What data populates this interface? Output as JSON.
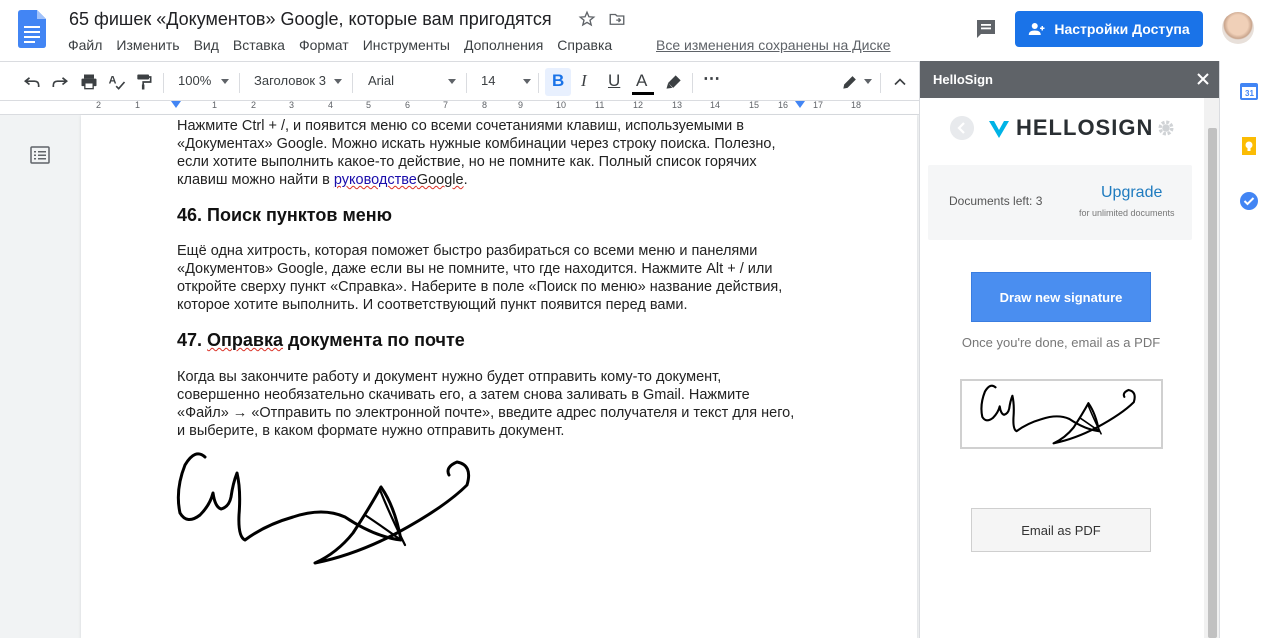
{
  "document": {
    "title": "65 фишек «Документов» Google, которые вам пригодятся",
    "saved_status": "Все изменения сохранены на Диске"
  },
  "menu": [
    "Файл",
    "Изменить",
    "Вид",
    "Вставка",
    "Формат",
    "Инструменты",
    "Дополнения",
    "Справка"
  ],
  "share": {
    "label": "Настройки Доступа"
  },
  "toolbar": {
    "zoom": "100%",
    "style": "Заголовок 3",
    "font": "Arial",
    "size": "14",
    "bold": "B",
    "italic": "I",
    "underline": "U",
    "text_color": "A",
    "more": "⋯"
  },
  "ruler": [
    "2",
    "1",
    "1",
    "2",
    "3",
    "4",
    "5",
    "6",
    "7",
    "8",
    "9",
    "10",
    "11",
    "12",
    "13",
    "14",
    "15",
    "16",
    "17",
    "18"
  ],
  "body": {
    "p1_a": "Нажмите Ctrl + /, и появится меню со всеми сочетаниями клавиш, используемыми в «Документах» Google. Можно искать нужные комбинации через строку поиска. Полезно, если хотите выполнить какое-то действие, но не помните как. Полный список горячих клавиш можно найти в ",
    "p1_link": "руководстве",
    "p1_b": "Google",
    "p1_end": ".",
    "h46": "46. Поиск пунктов меню",
    "p2": "Ещё одна хитрость, которая поможет быстро разбираться со всеми меню и панелями «Документов» Google, даже если вы не помните, что где находится. Нажмите Alt + / или откройте сверху пункт «Справка». Наберите в поле «Поиск по меню» название действия, которое хотите выполнить. И соответствующий пункт появится перед вами.",
    "h47_a": "47. ",
    "h47_b": "Оправка",
    "h47_c": " документа по почте",
    "p3": "Когда вы закончите работу и документ нужно будет отправить кому-то документ, совершенно необязательно скачивать его, а затем снова заливать в Gmail. Нажмите «Файл» → «Отправить по электронной почте», введите адрес получателя и текст для него, и выберите, в каком формате нужно отправить документ."
  },
  "panel": {
    "title": "HelloSign",
    "logo_text": "HELLOSIGN",
    "documents_left": "Documents left: 3",
    "upgrade": "Upgrade",
    "unlimited": "for unlimited documents",
    "draw_button": "Draw new signature",
    "once_done": "Once you're done, email as a PDF",
    "email_button": "Email as PDF"
  },
  "colors": {
    "share_blue": "#1a73e8",
    "hellosign_teal": "#00b3e6",
    "draw_button": "#4a8ef0"
  }
}
